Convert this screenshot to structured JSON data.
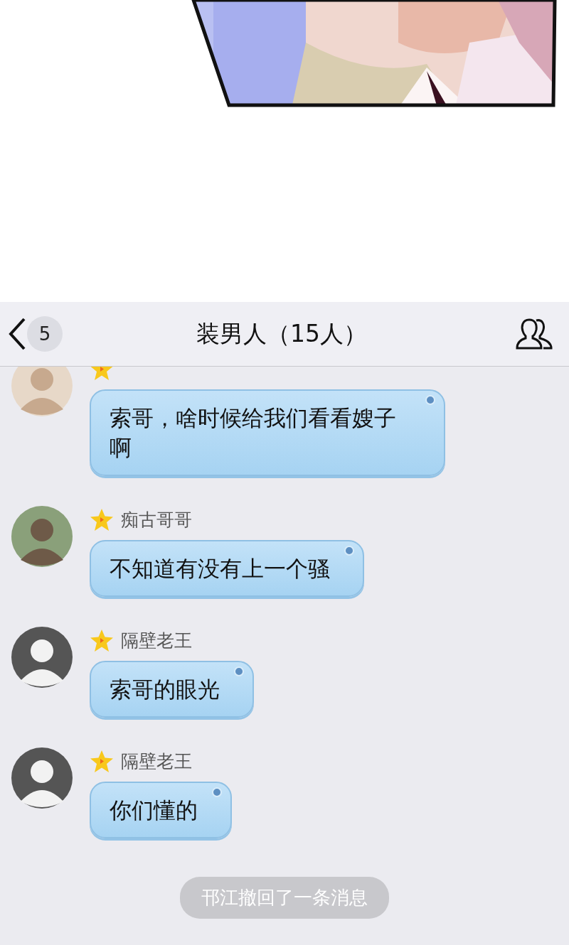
{
  "header": {
    "unread_count": "5",
    "title": "装男人（15人）"
  },
  "messages": [
    {
      "text": "索哥，啥时候给我们看看嫂子啊"
    },
    {
      "sender": "痴古哥哥",
      "text": "不知道有没有上一个骚"
    },
    {
      "sender": "隔壁老王",
      "text": "索哥的眼光"
    },
    {
      "sender": "隔壁老王",
      "text": "你们懂的"
    }
  ],
  "system_notice": "邗江撤回了一条消息"
}
